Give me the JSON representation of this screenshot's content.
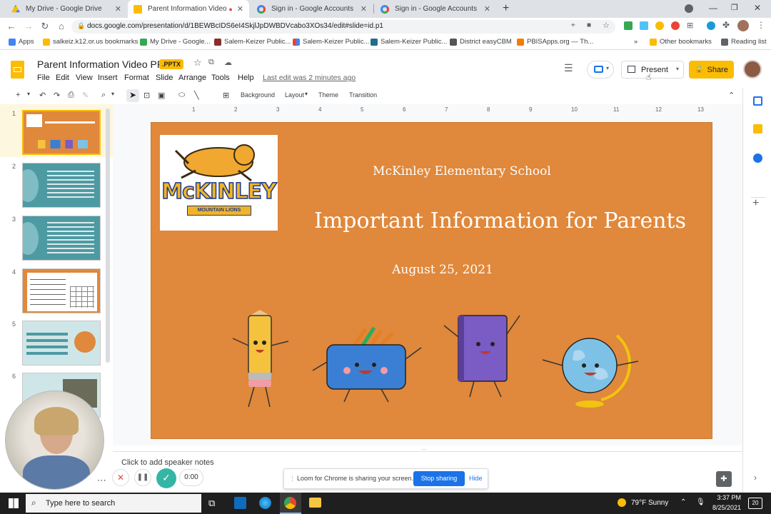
{
  "tabs": [
    {
      "title": "My Drive - Google Drive",
      "color": "#34a853"
    },
    {
      "title": "Parent Information Video PP",
      "color": "#fbbc04"
    },
    {
      "title": "Sign in - Google Accounts",
      "color": "#4285f4"
    },
    {
      "title": "Sign in - Google Accounts",
      "color": "#4285f4"
    }
  ],
  "url": "docs.google.com/presentation/d/1BEWBcIDS6eI4SkjlJpDWBDVcabo3XOs34/edit#slide=id.p1",
  "bookmarks": [
    {
      "label": "Apps"
    },
    {
      "label": "salkeiz.k12.or.us bookmarks"
    },
    {
      "label": "My Drive - Google..."
    },
    {
      "label": "Salem-Keizer Public..."
    },
    {
      "label": "Salem-Keizer Public..."
    },
    {
      "label": "Salem-Keizer Public..."
    },
    {
      "label": "District easyCBM"
    },
    {
      "label": "PBISApps.org — Th..."
    }
  ],
  "bookmarks_more": "»",
  "other_bookmarks": "Other bookmarks",
  "reading_list": "Reading list",
  "doc": {
    "title": "Parent Information Video PP",
    "badge": ".PPTX",
    "last_edit": "Last edit was 2 minutes ago",
    "present_label": "Present",
    "share_label": "Share"
  },
  "menu": [
    "File",
    "Edit",
    "View",
    "Insert",
    "Format",
    "Slide",
    "Arrange",
    "Tools",
    "Help"
  ],
  "toolbar": {
    "background": "Background",
    "layout": "Layout",
    "theme": "Theme",
    "transition": "Transition"
  },
  "ruler_marks": [
    "1",
    "2",
    "3",
    "4",
    "5",
    "6",
    "7",
    "8",
    "9",
    "10",
    "11",
    "12",
    "13"
  ],
  "slide_numbers": [
    "1",
    "2",
    "3",
    "4",
    "5",
    "6"
  ],
  "slide": {
    "logo_name": "McKINLEY",
    "logo_sub": "MOUNTAIN LIONS",
    "school": "McKinley Elementary School",
    "heading": "Important Information for Parents",
    "date": "August 25, 2021",
    "bg_color": "#e0883b"
  },
  "notes_placeholder": "Click to add speaker notes",
  "recorder": {
    "time": "0:00"
  },
  "loom": {
    "message": "Loom for Chrome is sharing your screen.",
    "stop": "Stop sharing",
    "hide": "Hide"
  },
  "taskbar": {
    "search": "Type here to search",
    "weather": "79°F  Sunny",
    "time": "3:37 PM",
    "date": "8/25/2021",
    "notif": "20"
  }
}
